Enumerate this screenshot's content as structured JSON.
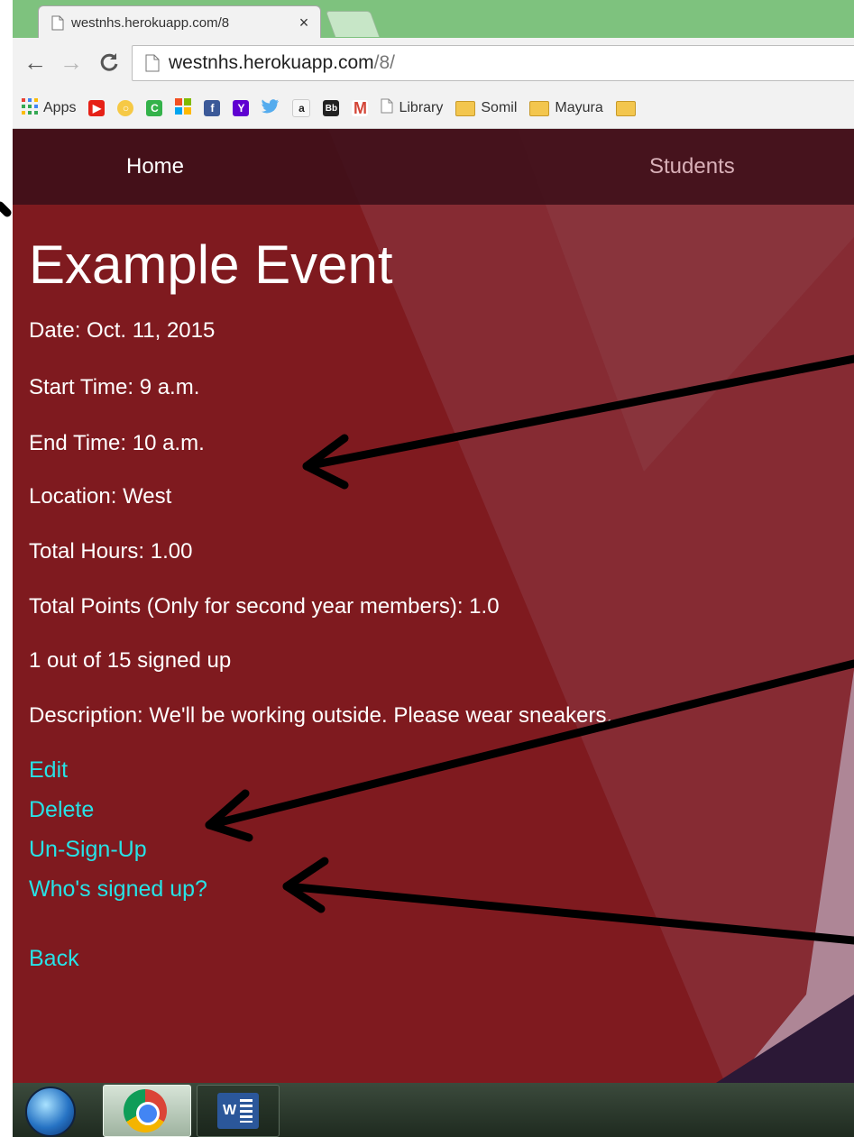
{
  "browser": {
    "tab_title": "westnhs.herokuapp.com/8",
    "tab_close": "×",
    "url_host": "westnhs.herokuapp.com",
    "url_path": "/8/"
  },
  "bookmarks": [
    {
      "label": "Apps",
      "icon": "apps-grid-icon"
    },
    {
      "label": "",
      "icon": "youtube-icon",
      "color": "#e62117"
    },
    {
      "label": "",
      "icon": "circle-icon",
      "color": "#f6c945"
    },
    {
      "label": "",
      "icon": "c-icon",
      "color": "#34b24a"
    },
    {
      "label": "",
      "icon": "windows-icon",
      "color": "#f25022"
    },
    {
      "label": "",
      "icon": "facebook-icon",
      "color": "#3b5998"
    },
    {
      "label": "",
      "icon": "yahoo-icon",
      "color": "#5f01d1"
    },
    {
      "label": "",
      "icon": "twitter-icon",
      "color": "#55acee"
    },
    {
      "label": "",
      "icon": "amazon-icon",
      "color": "#222222"
    },
    {
      "label": "",
      "icon": "blackboard-icon",
      "color": "#222222"
    },
    {
      "label": "",
      "icon": "gmail-icon",
      "color": "#d44638"
    },
    {
      "label": "Library",
      "icon": "page-icon"
    },
    {
      "label": "Somil",
      "icon": "folder-icon"
    },
    {
      "label": "Mayura",
      "icon": "folder-icon"
    }
  ],
  "site_nav": {
    "home": "Home",
    "students": "Students"
  },
  "event": {
    "title": "Example Event",
    "date": "Date: Oct. 11, 2015",
    "start_time": "Start Time: 9 a.m.",
    "end_time": "End Time: 10 a.m.",
    "location": "Location: West",
    "total_hours": "Total Hours: 1.00",
    "total_points": "Total Points (Only for second year members): 1.0",
    "signed_up": "1 out of 15 signed up",
    "description": "Description: We'll be working outside. Please wear sneakers."
  },
  "actions": {
    "edit": "Edit",
    "delete": "Delete",
    "unsignup": "Un-Sign-Up",
    "whos_signed_up": "Who's signed up?",
    "back": "Back"
  },
  "colors": {
    "page_bg": "#7f1a1f",
    "link": "#27e2e6",
    "nav_bg": "#3c0f19"
  }
}
